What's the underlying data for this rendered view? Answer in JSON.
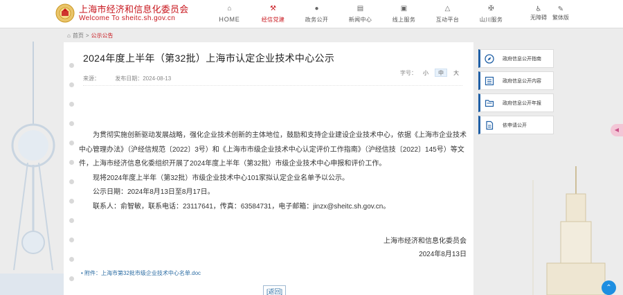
{
  "header": {
    "logo_cn": "上海市经济和信息化委员会",
    "logo_en": "Welcome  To  sheitc.sh.gov.cn",
    "nav": [
      {
        "label": "HOME",
        "icon": "home-icon",
        "active": false
      },
      {
        "label": "经信党建",
        "icon": "party-emblem-icon",
        "active": true
      },
      {
        "label": "政务公开",
        "icon": "chat-bubble-icon",
        "active": false
      },
      {
        "label": "新闻中心",
        "icon": "news-icon",
        "active": false
      },
      {
        "label": "线上服务",
        "icon": "online-service-icon",
        "active": false
      },
      {
        "label": "互动平台",
        "icon": "interaction-icon",
        "active": false
      },
      {
        "label": "山川服务",
        "icon": "mountain-service-icon",
        "active": false
      }
    ],
    "tools": [
      {
        "label": "无障碍",
        "icon": "accessibility-icon"
      },
      {
        "label": "繁体版",
        "icon": "traditional-chinese-icon"
      }
    ]
  },
  "breadcrumb": {
    "home": "首页",
    "separator": ">",
    "current": "公示公告"
  },
  "article": {
    "title": "2024年度上半年（第32批）上海市认定企业技术中心公示",
    "source_label": "来源：",
    "date_label": "发布日期：2024-08-13",
    "fontsize_label": "字号：",
    "fontsize_options": [
      "小",
      "中",
      "大"
    ],
    "paragraphs": [
      "为贯彻实施创新驱动发展战略，强化企业技术创新的主体地位，鼓励和支持企业建设企业技术中心，依据《上海市企业技术中心管理办法》（沪经信规范〔2022〕3号）和《上海市市级企业技术中心认定评价工作指南》（沪经信技〔2022〕145号）等文件，上海市经济信息化委组织开展了2024年度上半年（第32批）市级企业技术中心申报和评价工作。",
      "现将2024年度上半年（第32批）市级企业技术中心101家拟认定企业名单予以公示。",
      "公示日期：2024年8月13日至8月17日。",
      "联系人：俞智敏，联系电话：23117641，传真：63584731，电子邮箱：jinzx@sheitc.sh.gov.cn。"
    ],
    "signature_org": "上海市经济和信息化委员会",
    "signature_date": "2024年8月13日",
    "attachment": "• 附件：上海市第32批市级企业技术中心名单.doc",
    "back_label": "[返回]"
  },
  "sidebar": [
    {
      "label": "政府信息公开指南",
      "icon": "compass-icon"
    },
    {
      "label": "政府信息公开内容",
      "icon": "list-icon"
    },
    {
      "label": "政府信息公开年报",
      "icon": "folder-icon"
    },
    {
      "label": "依申请公开",
      "icon": "document-icon"
    }
  ],
  "colors": {
    "brand_red": "#c8161d",
    "link_blue": "#2b6ca3",
    "accent_blue": "#1f5fa5",
    "top_button": "#1e8fe1"
  },
  "floating": {
    "side_tab_icon": "floating-tab-icon",
    "to_top_icon": "chevron-up-icon"
  }
}
